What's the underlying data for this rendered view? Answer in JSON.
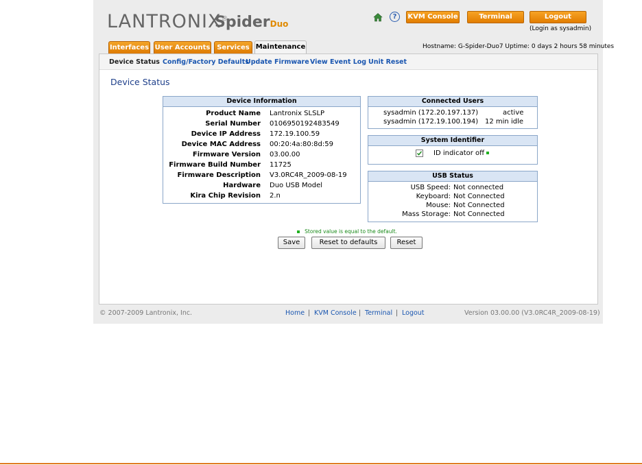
{
  "brand": {
    "name": "LANTRONIX",
    "reg": "®",
    "product": "Spider",
    "product_sub": "Duo"
  },
  "header": {
    "kvm_console": "KVM Console",
    "terminal": "Terminal",
    "logout": "Logout",
    "login_as": "(Login as sysadmin)"
  },
  "tabs": [
    {
      "label": "Interfaces"
    },
    {
      "label": "User Accounts"
    },
    {
      "label": "Services"
    },
    {
      "label": "Maintenance",
      "active": true
    }
  ],
  "status_line": "Hostname: G-Spider-Duo7    Uptime: 0 days 2 hours 58 minutes",
  "subnav": [
    "Device Status",
    "Config/Factory Defaults",
    "Update Firmware",
    "View Event Log",
    "Unit Reset"
  ],
  "page_title": "Device Status",
  "device_info": {
    "title": "Device Information",
    "rows": [
      {
        "label": "Product Name",
        "value": "Lantronix SLSLP"
      },
      {
        "label": "Serial Number",
        "value": "0106950192483549"
      },
      {
        "label": "Device IP Address",
        "value": "172.19.100.59"
      },
      {
        "label": "Device MAC Address",
        "value": "00:20:4a:80:8d:59"
      },
      {
        "label": "Firmware Version",
        "value": "03.00.00"
      },
      {
        "label": "Firmware Build Number",
        "value": "11725"
      },
      {
        "label": "Firmware Description",
        "value": "V3.0RC4R_2009-08-19"
      },
      {
        "label": "Hardware",
        "value": "Duo USB Model"
      },
      {
        "label": "Kira Chip Revision",
        "value": "2.n"
      }
    ]
  },
  "connected_users": {
    "title": "Connected Users",
    "rows": [
      {
        "user": "sysadmin (172.20.197.137)",
        "state": "active"
      },
      {
        "user": "sysadmin (172.19.100.194)",
        "state": "12 min idle"
      }
    ]
  },
  "system_identifier": {
    "title": "System Identifier",
    "label": "ID indicator off",
    "checked": true
  },
  "usb_status": {
    "title": "USB Status",
    "rows": [
      {
        "label": "USB Speed:",
        "value": "Not connected"
      },
      {
        "label": "Keyboard:",
        "value": "Not Connected"
      },
      {
        "label": "Mouse:",
        "value": "Not Connected"
      },
      {
        "label": "Mass Storage:",
        "value": "Not Connected"
      }
    ]
  },
  "note": "Stored value is equal to the default.",
  "buttons": {
    "save": "Save",
    "reset_defaults": "Reset to defaults",
    "reset": "Reset"
  },
  "footer": {
    "copyright": "© 2007-2009 Lantronix, Inc.",
    "links": [
      "Home",
      "KVM Console",
      "Terminal",
      "Logout"
    ],
    "sep": "|",
    "version": "Version 03.00.00 (V3.0RC4R_2009-08-19)"
  },
  "colors": {
    "accent_orange": "#e88a10",
    "link_blue": "#1a56b0",
    "box_header": "#d9e5f4",
    "title_blue": "#1e3f8a"
  }
}
